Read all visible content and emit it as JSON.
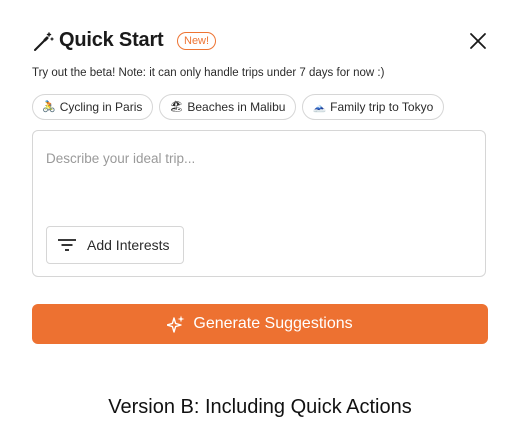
{
  "header": {
    "title": "Quick Start",
    "badge": "New!",
    "icon": "magic-wand-icon",
    "close_icon": "close-icon"
  },
  "subtitle": "Try out the beta! Note: it can only handle trips under 7 days for now :)",
  "chips": [
    {
      "emoji": "🚴",
      "label": "Cycling in Paris"
    },
    {
      "emoji": "🏖",
      "label": "Beaches in Malibu"
    },
    {
      "emoji": "🗻",
      "label": "Family trip to Tokyo"
    }
  ],
  "trip_input": {
    "placeholder": "Describe your ideal trip..."
  },
  "interests_button": {
    "label": "Add Interests",
    "icon": "filter-icon"
  },
  "generate_button": {
    "label": "Generate Suggestions",
    "icon": "sparkle-icon"
  },
  "caption": "Version B: Including Quick Actions",
  "colors": {
    "accent": "#ed7131",
    "border": "#d6d6d6",
    "placeholder": "#9a9a9a"
  }
}
